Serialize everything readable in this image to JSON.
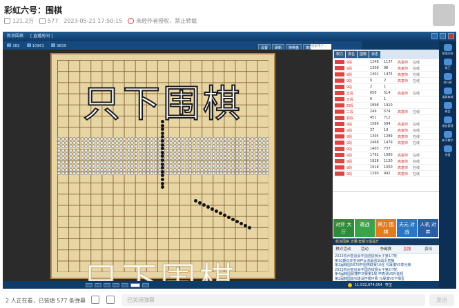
{
  "header": {
    "title": "彩虹六号：围棋",
    "views": "121.2万",
    "danmaku": "577",
    "datetime": "2023-05-21 17:50:15",
    "notice": "未经作者授权，禁止转载"
  },
  "app": {
    "window_title": "新浪围棋",
    "room": "[ 直播房间 ]",
    "counts": [
      "382",
      "10961",
      "3839"
    ],
    "toolbar": [
      "设置",
      "刷新",
      "换棋盘",
      "离开"
    ],
    "search_placeholder": "搜索用户..."
  },
  "board": {
    "line1": "只下围棋",
    "line2": "只下围棋"
  },
  "side": {
    "tabs": [
      "棋力",
      "排名",
      "国籍",
      "状态"
    ],
    "players": [
      {
        "n": "9段",
        "r": "1248",
        "p": "1137",
        "s": "高富帅",
        "f": "在线"
      },
      {
        "n": "9段",
        "r": "1308",
        "p": "98",
        "s": "高富帅",
        "f": "在线"
      },
      {
        "n": "9段",
        "r": "1401",
        "p": "1475",
        "s": "高富帅",
        "f": "在线"
      },
      {
        "n": "9段",
        "r": "0",
        "p": "2",
        "s": "高富帅",
        "f": "在线"
      },
      {
        "n": "9段",
        "r": "2",
        "p": "1",
        "s": "",
        "f": ""
      },
      {
        "n": "五段",
        "r": "650",
        "p": "514",
        "s": "高富帅",
        "f": "在线"
      },
      {
        "n": "五段",
        "r": "0",
        "p": "1",
        "s": "",
        "f": ""
      },
      {
        "n": "四段",
        "r": "1898",
        "p": "1910",
        "s": "",
        "f": ""
      },
      {
        "n": "二段",
        "r": "249",
        "p": "574",
        "s": "高富帅",
        "f": "在线"
      },
      {
        "n": "初段",
        "r": "451",
        "p": "712",
        "s": "",
        "f": ""
      },
      {
        "n": "9段",
        "r": "1586",
        "p": "594",
        "s": "高富帅",
        "f": "在线"
      },
      {
        "n": "9段",
        "r": "37",
        "p": "19",
        "s": "高富帅",
        "f": "在线"
      },
      {
        "n": "9段",
        "r": "1305",
        "p": "1289",
        "s": "高富帅",
        "f": "在线"
      },
      {
        "n": "9段",
        "r": "2468",
        "p": "1479",
        "s": "高富帅",
        "f": "在线"
      },
      {
        "n": "9段",
        "r": "1403",
        "p": "737",
        "s": "",
        "f": ""
      },
      {
        "n": "9段",
        "r": "1792",
        "p": "1080",
        "s": "高富帅",
        "f": "在线"
      },
      {
        "n": "9段",
        "r": "1928",
        "p": "1120",
        "s": "高富帅",
        "f": "在线"
      },
      {
        "n": "9段",
        "r": "1918",
        "p": "1050",
        "s": "高富帅",
        "f": "在线"
      },
      {
        "n": "9段",
        "r": "1290",
        "p": "942",
        "s": "高富帅",
        "f": "在线"
      }
    ],
    "modes": [
      "对弈\n大厅",
      "邀战",
      "棋力\n围棋",
      "天元\n对战",
      "人机\n对弈"
    ],
    "promo": "新浪围棋 流量/套餐大幅提升",
    "news_tabs": [
      "棋评活动",
      "活动",
      "争霸赛",
      "直播",
      "资讯"
    ],
    "news": [
      "2023杭州亚运会中国选拔赛女子第1/7轮",
      "第10期日本亚洲杯女流最强战战况直播",
      "第2届韩国5678杯围棋联赛16强 元晟溱VS李光荣",
      "2023杭州亚运会中国选拔赛女子第2/7轮",
      "第4届韩国晨捷杯决赛第1局 申真谞VS朴廷桓",
      "第2届韩国BYK建设杯循环赛 元晟溱VS卞相壹",
      "2023韩国围棋之神赛",
      "第8期韩国人气争霸赛决赛第2局 朴永训VS朴终勋"
    ],
    "coins": "11,532,674,054",
    "status_label": "夺宝"
  },
  "rightbar": [
    "棋境问答",
    "棋王",
    "排行榜",
    "道具商城",
    "棋会",
    "棋友管理",
    "新手教学",
    "充值"
  ],
  "footer": {
    "viewers": "2 人正在看，已装填 577 条弹幕",
    "placeholder": "已关闭弹幕",
    "send": "发送"
  }
}
